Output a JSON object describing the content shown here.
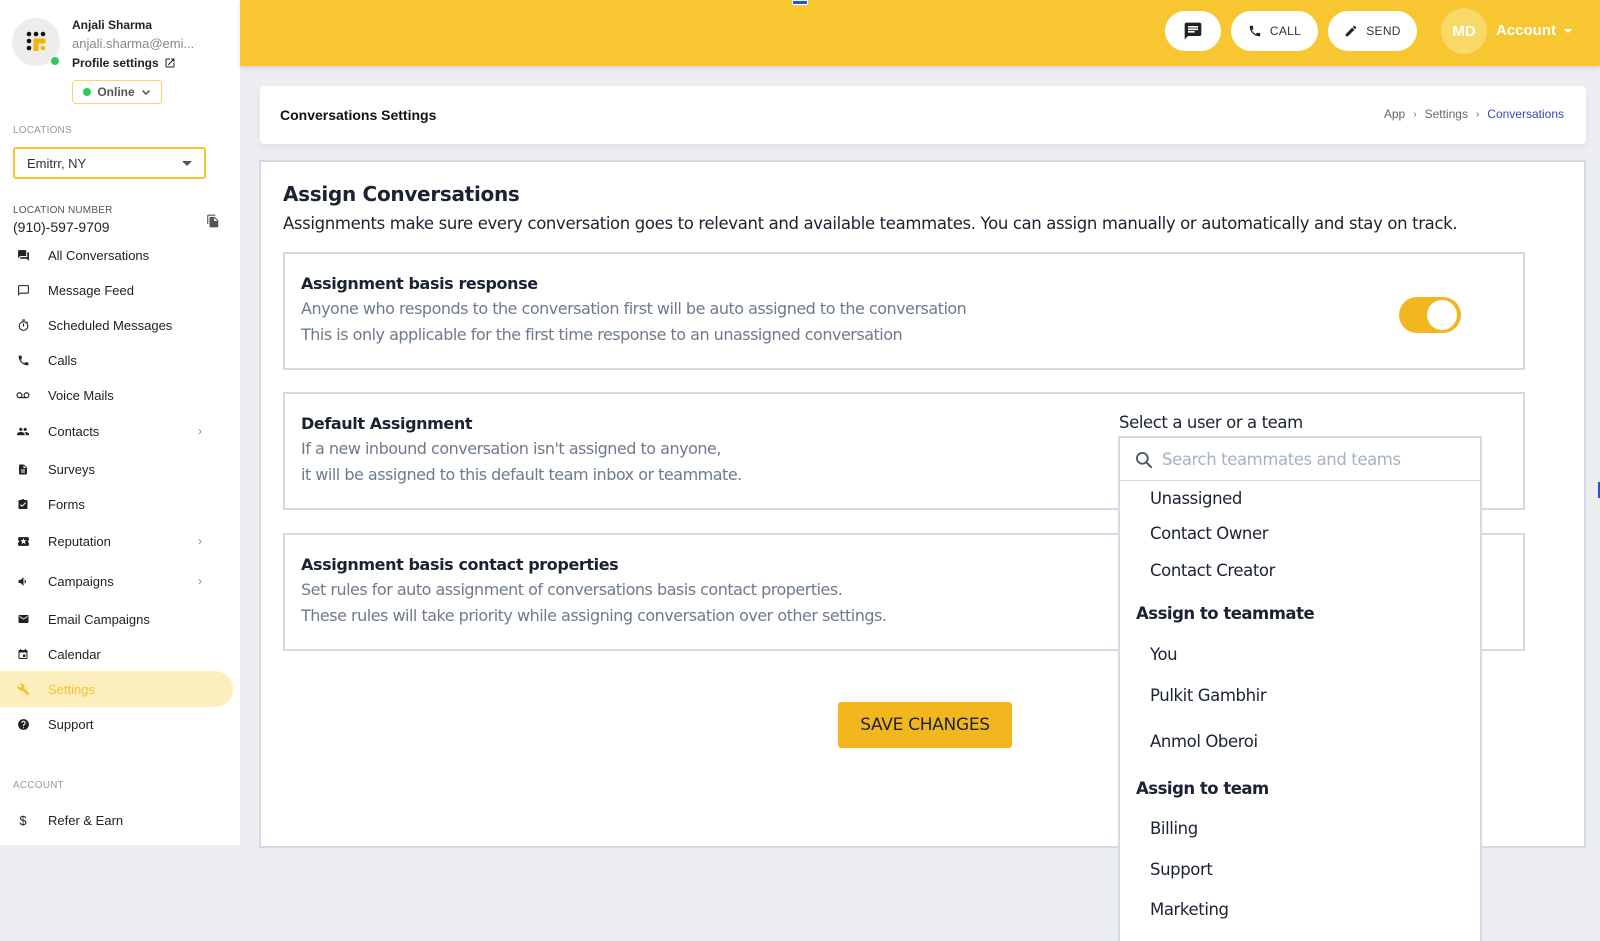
{
  "profile": {
    "name": "Anjali Sharma",
    "email": "anjali.sharma@emi...",
    "settings_link": "Profile settings",
    "status": "Online",
    "status_color": "#2ecc55"
  },
  "sidebar": {
    "locations_label": "LOCATIONS",
    "location_selected": "Emitrr, NY",
    "location_number_label": "LOCATION NUMBER",
    "location_number": "(910)-597-9709",
    "items": [
      {
        "label": "All Conversations",
        "icon": "forum-icon",
        "has_children": false
      },
      {
        "label": "Message Feed",
        "icon": "message-icon",
        "has_children": false
      },
      {
        "label": "Scheduled Messages",
        "icon": "timer-icon",
        "has_children": false
      },
      {
        "label": "Calls",
        "icon": "phone-icon",
        "has_children": false
      },
      {
        "label": "Voice Mails",
        "icon": "voicemail-icon",
        "has_children": false
      },
      {
        "label": "Contacts",
        "icon": "people-icon",
        "has_children": true
      },
      {
        "label": "Surveys",
        "icon": "document-icon",
        "has_children": false
      },
      {
        "label": "Forms",
        "icon": "clipboard-check-icon",
        "has_children": false
      },
      {
        "label": "Reputation",
        "icon": "ticket-star-icon",
        "has_children": true
      },
      {
        "label": "Campaigns",
        "icon": "megaphone-icon",
        "has_children": true
      },
      {
        "label": "Email Campaigns",
        "icon": "mail-icon",
        "has_children": false
      },
      {
        "label": "Calendar",
        "icon": "calendar-icon",
        "has_children": false
      },
      {
        "label": "Settings",
        "icon": "wrench-icon",
        "has_children": false,
        "active": true
      },
      {
        "label": "Support",
        "icon": "help-icon",
        "has_children": false
      }
    ],
    "account_label": "ACCOUNT",
    "account_items": [
      {
        "label": "Refer & Earn",
        "icon": "dollar-icon"
      }
    ]
  },
  "topbar": {
    "chat_icon": "chat-icon",
    "call_label": "CALL",
    "send_label": "SEND",
    "avatar_initials": "MD",
    "account_label": "Account",
    "brand_color": "#f7c631"
  },
  "header": {
    "title": "Conversations Settings",
    "breadcrumb": [
      "App",
      "Settings",
      "Conversations"
    ]
  },
  "main": {
    "title": "Assign Conversations",
    "description": "Assignments make sure every conversation goes to relevant and available teammates. You can assign manually or automatically and stay on track.",
    "sections": [
      {
        "title": "Assignment basis response",
        "lines": [
          "Anyone who responds to the conversation first will be auto assigned to the conversation",
          "This is only applicable for the first time response to an unassigned conversation"
        ],
        "toggle_on": true
      },
      {
        "title": "Default Assignment",
        "lines": [
          "If a new inbound conversation isn't assigned to anyone,",
          "it will be assigned to this default team inbox or teammate."
        ]
      },
      {
        "title": "Assignment basis contact properties",
        "lines": [
          "Set rules for auto assignment of conversations basis contact properties.",
          "These rules will take priority while assigning conversation over other settings."
        ]
      }
    ],
    "save_label": "SAVE CHANGES"
  },
  "assignee_picker": {
    "label": "Select a user or a team",
    "search_placeholder": "Search teammates and teams",
    "search_value": "",
    "options": [
      "Unassigned",
      "Contact Owner",
      "Contact Creator"
    ],
    "groups": [
      {
        "label": "Assign to teammate",
        "items": [
          "You",
          "Pulkit Gambhir",
          "Anmol Oberoi"
        ]
      },
      {
        "label": "Assign to team",
        "items": [
          "Billing",
          "Support",
          "Marketing"
        ]
      }
    ]
  }
}
